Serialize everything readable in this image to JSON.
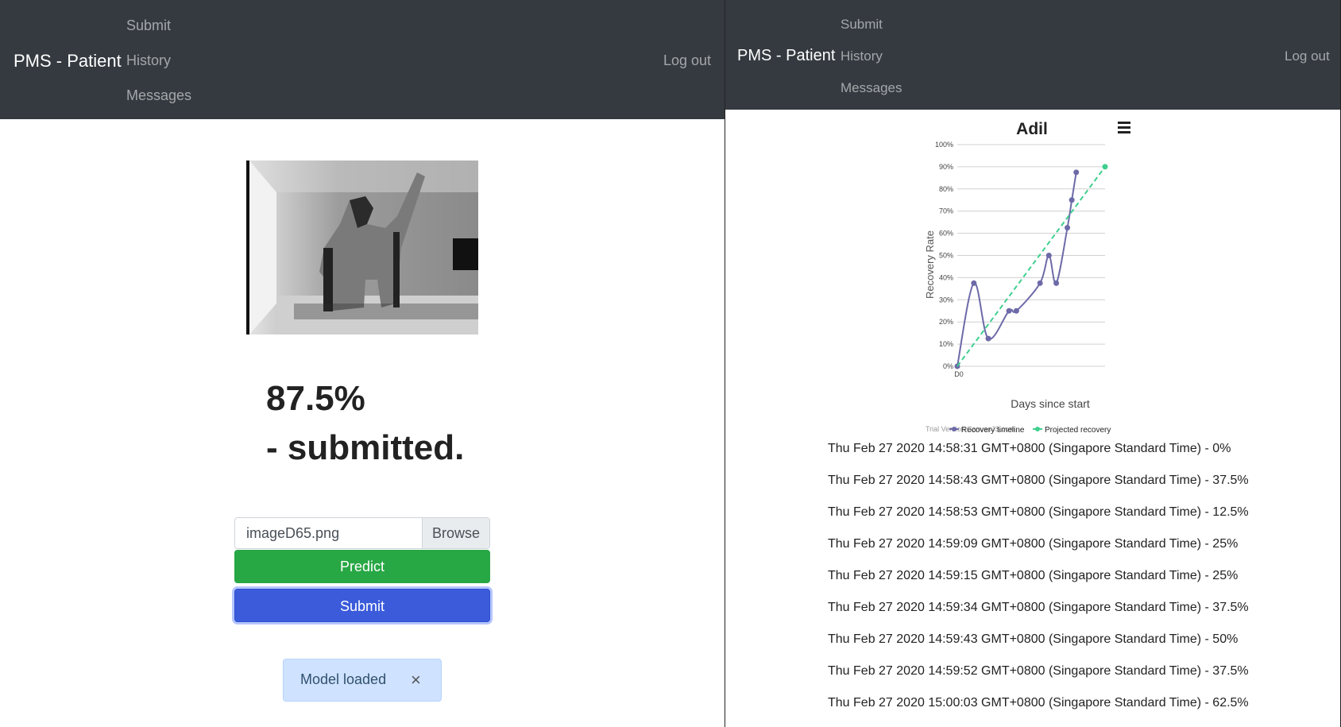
{
  "left_panel": {
    "nav": {
      "brand": "PMS - Patient",
      "links": [
        "Submit",
        "History",
        "Messages"
      ],
      "logout": "Log out"
    },
    "result": {
      "percent": "87.5%",
      "status": "- submitted."
    },
    "form": {
      "file_name": "imageD65.png",
      "browse_label": "Browse",
      "predict_label": "Predict",
      "submit_label": "Submit"
    },
    "toast": {
      "message": "Model loaded",
      "close_symbol": "×"
    }
  },
  "right_panel": {
    "nav": {
      "brand": "PMS - Patient",
      "links": [
        "Submit",
        "History",
        "Messages"
      ],
      "logout": "Log out"
    },
    "menu_icon": "hamburger-icon",
    "history": [
      "Thu Feb 27 2020 14:58:31 GMT+0800 (Singapore Standard Time) - 0%",
      "Thu Feb 27 2020 14:58:43 GMT+0800 (Singapore Standard Time) - 37.5%",
      "Thu Feb 27 2020 14:58:53 GMT+0800 (Singapore Standard Time) - 12.5%",
      "Thu Feb 27 2020 14:59:09 GMT+0800 (Singapore Standard Time) - 25%",
      "Thu Feb 27 2020 14:59:15 GMT+0800 (Singapore Standard Time) - 25%",
      "Thu Feb 27 2020 14:59:34 GMT+0800 (Singapore Standard Time) - 37.5%",
      "Thu Feb 27 2020 14:59:43 GMT+0800 (Singapore Standard Time) - 50%",
      "Thu Feb 27 2020 14:59:52 GMT+0800 (Singapore Standard Time) - 37.5%",
      "Thu Feb 27 2020 15:00:03 GMT+0800 (Singapore Standard Time) - 62.5%"
    ]
  },
  "chart_data": {
    "type": "line",
    "title": "Adil",
    "xlabel": "Days since start",
    "ylabel": "Recovery Rate",
    "x_ticks": [
      "D0"
    ],
    "y_ticks": [
      "0%",
      "10%",
      "20%",
      "30%",
      "40%",
      "50%",
      "60%",
      "70%",
      "80%",
      "90%",
      "100%"
    ],
    "ylim": [
      0,
      100
    ],
    "grid": true,
    "legend_position": "bottom",
    "watermark": "Trial Version CanvasJS.com",
    "series": [
      {
        "name": "Recovery timeline",
        "color": "#6d6aa8",
        "points": [
          {
            "x": 0,
            "y": 0
          },
          {
            "x": 1.12,
            "y": 37.5
          },
          {
            "x": 2.1,
            "y": 12.5
          },
          {
            "x": 3.5,
            "y": 25
          },
          {
            "x": 4.0,
            "y": 25
          },
          {
            "x": 5.6,
            "y": 37.5
          },
          {
            "x": 6.2,
            "y": 50
          },
          {
            "x": 6.7,
            "y": 37.5
          },
          {
            "x": 7.45,
            "y": 62.5
          },
          {
            "x": 7.75,
            "y": 75
          },
          {
            "x": 8.05,
            "y": 87.5
          }
        ]
      },
      {
        "name": "Projected recovery",
        "color": "#3ecf8e",
        "dashed": true,
        "points": [
          {
            "x": 0,
            "y": 0
          },
          {
            "x": 10,
            "y": 90
          }
        ]
      }
    ],
    "x_range": [
      0,
      10
    ]
  }
}
